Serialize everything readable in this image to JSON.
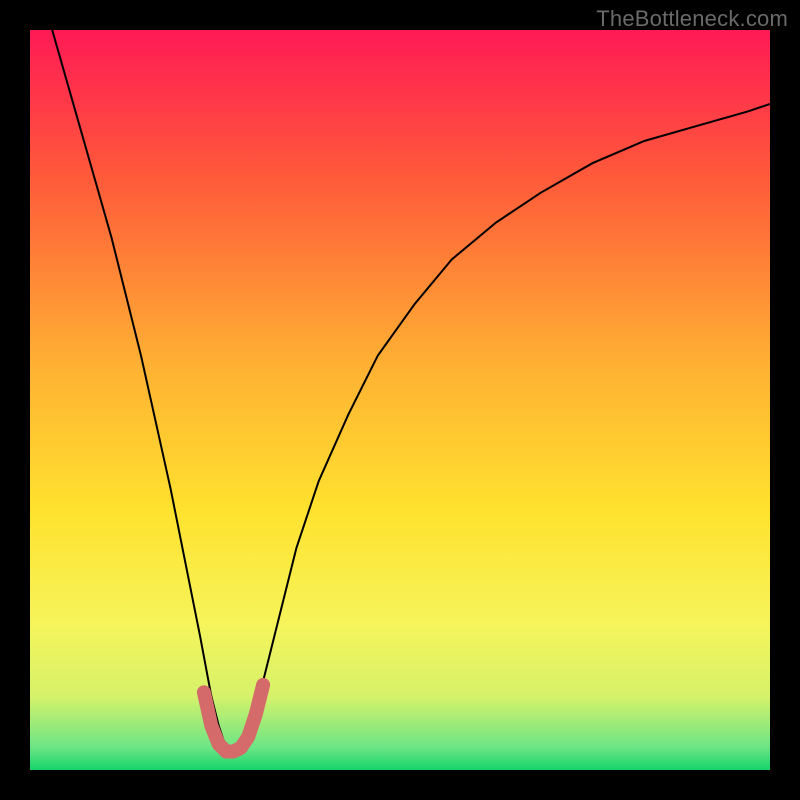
{
  "watermark": "TheBottleneck.com",
  "chart_data": {
    "type": "line",
    "title": "",
    "xlabel": "",
    "ylabel": "",
    "xlim": [
      0,
      1
    ],
    "ylim": [
      0,
      1
    ],
    "axes_visible": false,
    "grid": false,
    "background_gradient": {
      "stops": [
        {
          "offset": 0.0,
          "color": "#ff1a55"
        },
        {
          "offset": 0.2,
          "color": "#ff5a3a"
        },
        {
          "offset": 0.45,
          "color": "#ffb033"
        },
        {
          "offset": 0.65,
          "color": "#ffe22e"
        },
        {
          "offset": 0.8,
          "color": "#f6f45a"
        },
        {
          "offset": 0.9,
          "color": "#d6f26a"
        },
        {
          "offset": 0.97,
          "color": "#6be585"
        },
        {
          "offset": 1.0,
          "color": "#14d46a"
        }
      ]
    },
    "series": [
      {
        "name": "bottleneck-curve",
        "stroke": "#000000",
        "stroke_width": 2,
        "x": [
          0.03,
          0.05,
          0.07,
          0.09,
          0.11,
          0.13,
          0.15,
          0.17,
          0.19,
          0.21,
          0.23,
          0.245,
          0.255,
          0.265,
          0.275,
          0.285,
          0.3,
          0.315,
          0.335,
          0.36,
          0.39,
          0.43,
          0.47,
          0.52,
          0.57,
          0.63,
          0.69,
          0.76,
          0.83,
          0.9,
          0.97,
          1.0
        ],
        "y": [
          1.0,
          0.93,
          0.86,
          0.79,
          0.72,
          0.64,
          0.56,
          0.47,
          0.38,
          0.28,
          0.18,
          0.1,
          0.06,
          0.03,
          0.03,
          0.04,
          0.07,
          0.12,
          0.2,
          0.3,
          0.39,
          0.48,
          0.56,
          0.63,
          0.69,
          0.74,
          0.78,
          0.82,
          0.85,
          0.87,
          0.89,
          0.9
        ]
      },
      {
        "name": "highlight-minimum",
        "stroke": "#d46a6a",
        "stroke_width": 14,
        "linecap": "round",
        "x": [
          0.235,
          0.245,
          0.255,
          0.265,
          0.275,
          0.285,
          0.295,
          0.305,
          0.315
        ],
        "y": [
          0.105,
          0.06,
          0.035,
          0.025,
          0.025,
          0.03,
          0.045,
          0.075,
          0.115
        ]
      }
    ],
    "notes": "Values are normalized fractions of the plot area (0..1). x=0 at left edge, y=0 at bottom edge. Curve dips to a minimum near x≈0.27 (highlighted in muted red), rises steeply out of the valley, then flattens toward the right."
  }
}
